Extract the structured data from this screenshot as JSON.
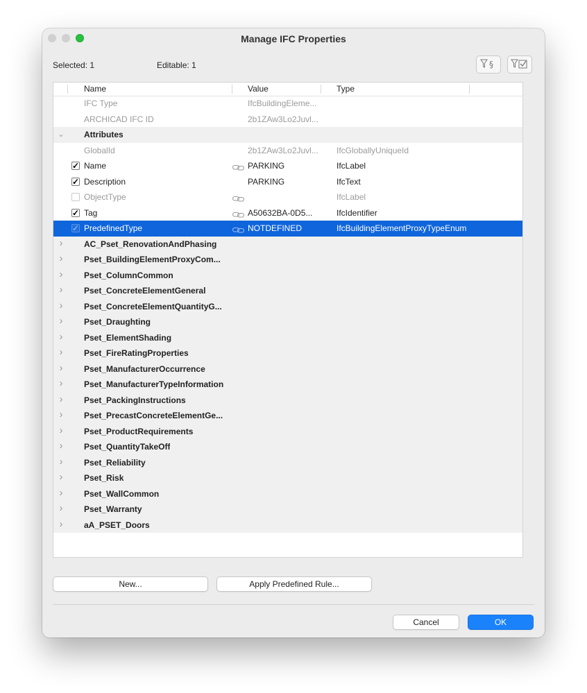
{
  "window": {
    "title": "Manage IFC Properties"
  },
  "info": {
    "selected": "Selected: 1",
    "editable": "Editable: 1"
  },
  "toolbar": {
    "filter_pset_icon": "filter-section-icon",
    "filter_check_icon": "filter-checkbox-icon"
  },
  "table": {
    "columns": {
      "name": "Name",
      "value": "Value",
      "type": "Type"
    },
    "rows": [
      {
        "kind": "meta",
        "name": "IFC Type",
        "value": "IfcBuildingEleme...",
        "type": ""
      },
      {
        "kind": "meta",
        "name": "ARCHICAD IFC ID",
        "value": "2b1ZAw3Lo2Juvl...",
        "type": ""
      },
      {
        "kind": "group-open",
        "name": "Attributes"
      },
      {
        "kind": "prop-dim",
        "check": "none",
        "link": false,
        "name": "GlobalId",
        "value": "2b1ZAw3Lo2Juvl...",
        "type": "IfcGloballyUniqueId"
      },
      {
        "kind": "prop",
        "check": "checked",
        "link": true,
        "name": "Name",
        "value": "PARKING",
        "type": "IfcLabel"
      },
      {
        "kind": "prop",
        "check": "checked",
        "link": false,
        "name": "Description",
        "value": "PARKING",
        "type": "IfcText"
      },
      {
        "kind": "prop-dim",
        "check": "disabled",
        "link": true,
        "name": "ObjectType",
        "value": "",
        "type": "IfcLabel"
      },
      {
        "kind": "prop",
        "check": "checked",
        "link": true,
        "name": "Tag",
        "value": "A50632BA-0D5...",
        "type": "IfcIdentifier"
      },
      {
        "kind": "prop-selected",
        "check": "checked",
        "link": true,
        "name": "PredefinedType",
        "value": "NOTDEFINED",
        "type": "IfcBuildingElementProxyTypeEnum"
      },
      {
        "kind": "group",
        "name": "AC_Pset_RenovationAndPhasing"
      },
      {
        "kind": "group",
        "name": "Pset_BuildingElementProxyCom..."
      },
      {
        "kind": "group",
        "name": "Pset_ColumnCommon"
      },
      {
        "kind": "group",
        "name": "Pset_ConcreteElementGeneral"
      },
      {
        "kind": "group",
        "name": "Pset_ConcreteElementQuantityG..."
      },
      {
        "kind": "group",
        "name": "Pset_Draughting"
      },
      {
        "kind": "group",
        "name": "Pset_ElementShading"
      },
      {
        "kind": "group",
        "name": "Pset_FireRatingProperties"
      },
      {
        "kind": "group",
        "name": "Pset_ManufacturerOccurrence"
      },
      {
        "kind": "group",
        "name": "Pset_ManufacturerTypeInformation"
      },
      {
        "kind": "group",
        "name": "Pset_PackingInstructions"
      },
      {
        "kind": "group",
        "name": "Pset_PrecastConcreteElementGe..."
      },
      {
        "kind": "group",
        "name": "Pset_ProductRequirements"
      },
      {
        "kind": "group",
        "name": "Pset_QuantityTakeOff"
      },
      {
        "kind": "group",
        "name": "Pset_Reliability"
      },
      {
        "kind": "group",
        "name": "Pset_Risk"
      },
      {
        "kind": "group",
        "name": "Pset_WallCommon"
      },
      {
        "kind": "group",
        "name": "Pset_Warranty"
      },
      {
        "kind": "group",
        "name": "aA_PSET_Doors"
      }
    ]
  },
  "buttons": {
    "new": "New...",
    "apply_rule": "Apply Predefined Rule...",
    "cancel": "Cancel",
    "ok": "OK"
  },
  "colors": {
    "selection": "#0f65db",
    "primary_button": "#1a82fb",
    "zoom_button": "#29c140"
  }
}
